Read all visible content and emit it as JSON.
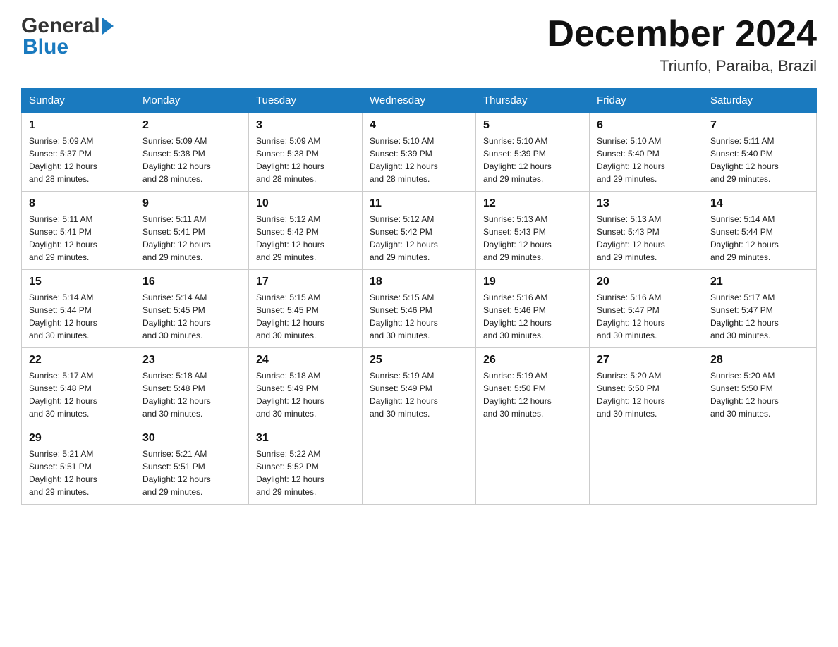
{
  "header": {
    "logo_general": "General",
    "logo_blue": "Blue",
    "month_title": "December 2024",
    "location": "Triunfo, Paraiba, Brazil"
  },
  "days_of_week": [
    "Sunday",
    "Monday",
    "Tuesday",
    "Wednesday",
    "Thursday",
    "Friday",
    "Saturday"
  ],
  "weeks": [
    [
      {
        "day": "1",
        "sunrise": "5:09 AM",
        "sunset": "5:37 PM",
        "daylight": "12 hours and 28 minutes."
      },
      {
        "day": "2",
        "sunrise": "5:09 AM",
        "sunset": "5:38 PM",
        "daylight": "12 hours and 28 minutes."
      },
      {
        "day": "3",
        "sunrise": "5:09 AM",
        "sunset": "5:38 PM",
        "daylight": "12 hours and 28 minutes."
      },
      {
        "day": "4",
        "sunrise": "5:10 AM",
        "sunset": "5:39 PM",
        "daylight": "12 hours and 28 minutes."
      },
      {
        "day": "5",
        "sunrise": "5:10 AM",
        "sunset": "5:39 PM",
        "daylight": "12 hours and 29 minutes."
      },
      {
        "day": "6",
        "sunrise": "5:10 AM",
        "sunset": "5:40 PM",
        "daylight": "12 hours and 29 minutes."
      },
      {
        "day": "7",
        "sunrise": "5:11 AM",
        "sunset": "5:40 PM",
        "daylight": "12 hours and 29 minutes."
      }
    ],
    [
      {
        "day": "8",
        "sunrise": "5:11 AM",
        "sunset": "5:41 PM",
        "daylight": "12 hours and 29 minutes."
      },
      {
        "day": "9",
        "sunrise": "5:11 AM",
        "sunset": "5:41 PM",
        "daylight": "12 hours and 29 minutes."
      },
      {
        "day": "10",
        "sunrise": "5:12 AM",
        "sunset": "5:42 PM",
        "daylight": "12 hours and 29 minutes."
      },
      {
        "day": "11",
        "sunrise": "5:12 AM",
        "sunset": "5:42 PM",
        "daylight": "12 hours and 29 minutes."
      },
      {
        "day": "12",
        "sunrise": "5:13 AM",
        "sunset": "5:43 PM",
        "daylight": "12 hours and 29 minutes."
      },
      {
        "day": "13",
        "sunrise": "5:13 AM",
        "sunset": "5:43 PM",
        "daylight": "12 hours and 29 minutes."
      },
      {
        "day": "14",
        "sunrise": "5:14 AM",
        "sunset": "5:44 PM",
        "daylight": "12 hours and 29 minutes."
      }
    ],
    [
      {
        "day": "15",
        "sunrise": "5:14 AM",
        "sunset": "5:44 PM",
        "daylight": "12 hours and 30 minutes."
      },
      {
        "day": "16",
        "sunrise": "5:14 AM",
        "sunset": "5:45 PM",
        "daylight": "12 hours and 30 minutes."
      },
      {
        "day": "17",
        "sunrise": "5:15 AM",
        "sunset": "5:45 PM",
        "daylight": "12 hours and 30 minutes."
      },
      {
        "day": "18",
        "sunrise": "5:15 AM",
        "sunset": "5:46 PM",
        "daylight": "12 hours and 30 minutes."
      },
      {
        "day": "19",
        "sunrise": "5:16 AM",
        "sunset": "5:46 PM",
        "daylight": "12 hours and 30 minutes."
      },
      {
        "day": "20",
        "sunrise": "5:16 AM",
        "sunset": "5:47 PM",
        "daylight": "12 hours and 30 minutes."
      },
      {
        "day": "21",
        "sunrise": "5:17 AM",
        "sunset": "5:47 PM",
        "daylight": "12 hours and 30 minutes."
      }
    ],
    [
      {
        "day": "22",
        "sunrise": "5:17 AM",
        "sunset": "5:48 PM",
        "daylight": "12 hours and 30 minutes."
      },
      {
        "day": "23",
        "sunrise": "5:18 AM",
        "sunset": "5:48 PM",
        "daylight": "12 hours and 30 minutes."
      },
      {
        "day": "24",
        "sunrise": "5:18 AM",
        "sunset": "5:49 PM",
        "daylight": "12 hours and 30 minutes."
      },
      {
        "day": "25",
        "sunrise": "5:19 AM",
        "sunset": "5:49 PM",
        "daylight": "12 hours and 30 minutes."
      },
      {
        "day": "26",
        "sunrise": "5:19 AM",
        "sunset": "5:50 PM",
        "daylight": "12 hours and 30 minutes."
      },
      {
        "day": "27",
        "sunrise": "5:20 AM",
        "sunset": "5:50 PM",
        "daylight": "12 hours and 30 minutes."
      },
      {
        "day": "28",
        "sunrise": "5:20 AM",
        "sunset": "5:50 PM",
        "daylight": "12 hours and 30 minutes."
      }
    ],
    [
      {
        "day": "29",
        "sunrise": "5:21 AM",
        "sunset": "5:51 PM",
        "daylight": "12 hours and 29 minutes."
      },
      {
        "day": "30",
        "sunrise": "5:21 AM",
        "sunset": "5:51 PM",
        "daylight": "12 hours and 29 minutes."
      },
      {
        "day": "31",
        "sunrise": "5:22 AM",
        "sunset": "5:52 PM",
        "daylight": "12 hours and 29 minutes."
      },
      null,
      null,
      null,
      null
    ]
  ],
  "labels": {
    "sunrise": "Sunrise:",
    "sunset": "Sunset:",
    "daylight": "Daylight:"
  },
  "colors": {
    "header_bg": "#1a7abf",
    "border": "#1a7abf",
    "accent_blue": "#1a7abf"
  }
}
